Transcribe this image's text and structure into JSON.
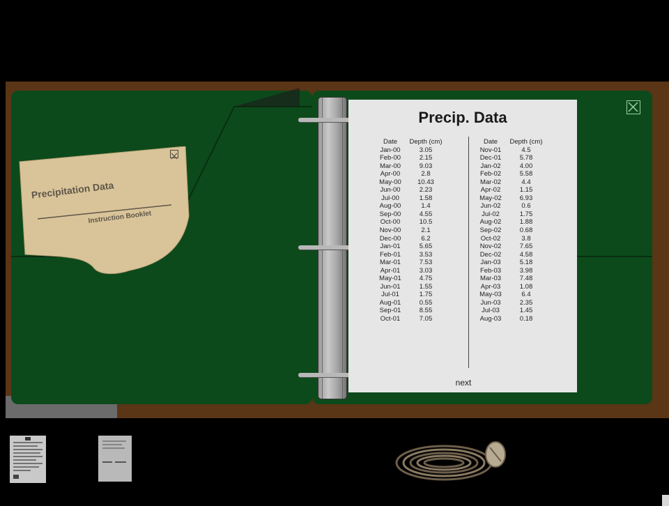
{
  "booklet": {
    "title": "Precipitation Data",
    "subtitle": "Instruction Booklet"
  },
  "page": {
    "title": "Precip. Data",
    "col_headers": {
      "date": "Date",
      "depth": "Depth (cm)"
    },
    "left_rows": [
      {
        "date": "Jan-00",
        "depth": "3.05"
      },
      {
        "date": "Feb-00",
        "depth": "2.15"
      },
      {
        "date": "Mar-00",
        "depth": "9.03"
      },
      {
        "date": "Apr-00",
        "depth": "2.8"
      },
      {
        "date": "May-00",
        "depth": "10.43"
      },
      {
        "date": "Jun-00",
        "depth": "2.23"
      },
      {
        "date": "Jul-00",
        "depth": "1.58"
      },
      {
        "date": "Aug-00",
        "depth": "1.4"
      },
      {
        "date": "Sep-00",
        "depth": "4.55"
      },
      {
        "date": "Oct-00",
        "depth": "10.5"
      },
      {
        "date": "Nov-00",
        "depth": "2.1"
      },
      {
        "date": "Dec-00",
        "depth": "6.2"
      },
      {
        "date": "Jan-01",
        "depth": "5.65"
      },
      {
        "date": "Feb-01",
        "depth": "3.53"
      },
      {
        "date": "Mar-01",
        "depth": "7.53"
      },
      {
        "date": "Apr-01",
        "depth": "3.03"
      },
      {
        "date": "May-01",
        "depth": "4.75"
      },
      {
        "date": "Jun-01",
        "depth": "1.55"
      },
      {
        "date": "Jul-01",
        "depth": "1.75"
      },
      {
        "date": "Aug-01",
        "depth": "0.55"
      },
      {
        "date": "Sep-01",
        "depth": "8.55"
      },
      {
        "date": "Oct-01",
        "depth": "7.05"
      }
    ],
    "right_rows": [
      {
        "date": "Nov-01",
        "depth": "4.5"
      },
      {
        "date": "Dec-01",
        "depth": "5.78"
      },
      {
        "date": "Jan-02",
        "depth": "4.00"
      },
      {
        "date": "Feb-02",
        "depth": "5.58"
      },
      {
        "date": "Mar-02",
        "depth": "4.4"
      },
      {
        "date": "Apr-02",
        "depth": "1.15"
      },
      {
        "date": "May-02",
        "depth": "6.93"
      },
      {
        "date": "Jun-02",
        "depth": "0.6"
      },
      {
        "date": "Jul-02",
        "depth": "1.75"
      },
      {
        "date": "Aug-02",
        "depth": "1.88"
      },
      {
        "date": "Sep-02",
        "depth": "0.68"
      },
      {
        "date": "Oct-02",
        "depth": "3.8"
      },
      {
        "date": "Nov-02",
        "depth": "7.65"
      },
      {
        "date": "Dec-02",
        "depth": "4.58"
      },
      {
        "date": "Jan-03",
        "depth": "5.18"
      },
      {
        "date": "Feb-03",
        "depth": "3.98"
      },
      {
        "date": "Mar-03",
        "depth": "7.48"
      },
      {
        "date": "Apr-03",
        "depth": "1.08"
      },
      {
        "date": "May-03",
        "depth": "6.4"
      },
      {
        "date": "Jun-03",
        "depth": "2.35"
      },
      {
        "date": "Jul-03",
        "depth": "1.45"
      },
      {
        "date": "Aug-03",
        "depth": "0.18"
      }
    ],
    "next_label": "next"
  },
  "icons": {
    "close": "close-icon",
    "booklet_close": "close-icon",
    "inventory_doc1": "document-icon",
    "inventory_doc2": "document-icon",
    "inventory_rope": "rope-icon"
  },
  "colors": {
    "binder_green": "#0d4a1b",
    "binder_brown": "#5a3516",
    "booklet_tan": "#d9c49a",
    "page_gray": "#e6e6e6"
  }
}
